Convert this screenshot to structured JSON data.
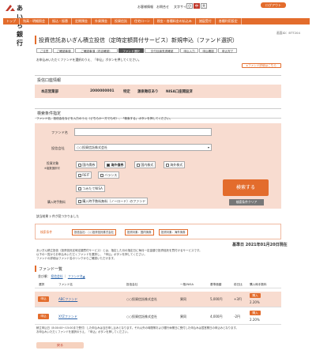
{
  "header": {
    "bank_name": "あいち銀行",
    "links": [
      "お客様情報",
      "お問合せ"
    ],
    "font_size_label": "文字サイズ",
    "font_sizes": [
      "小",
      "中",
      "大"
    ],
    "logout": "ログアウト"
  },
  "nav": {
    "items": [
      "トップ",
      "残高・明細照会",
      "振込・振替",
      "定期預金",
      "外貨預金",
      "投資信託",
      "住宅ローン",
      "税金・各種料金の払込み",
      "諸届受付",
      "各種利用設定"
    ]
  },
  "screen_id": "画面ID：BTT204",
  "page": {
    "title": "投資信託あいぎん積立投信（定時定額買付サービス）新規申込（ファンド選択）",
    "steps": [
      "ご注意",
      "ご確認事項",
      "ご確認事項（内容確認）",
      "ファンド選択",
      "交付目論見書確認",
      "申込入力",
      "申込確認",
      "申込完了"
    ],
    "active_step": 3,
    "instruction": "お申込みいただくファンドを選択のうえ、「申込」ボタンを押してください。",
    "doc_link": "ファンド詳細はこちら"
  },
  "account": {
    "section_title": "投信口座情報",
    "branch": "本店営業部",
    "number": "2000000001",
    "type": "特定",
    "tax": "源泉徴収あり",
    "nisa": "NISA口座開設済"
  },
  "search": {
    "section_title": "検索条件指定",
    "hint": "ファンド名、投信会社などを入力のうえ（どちらか一方でも可）、「検索する」ボタンを押してください。",
    "fund_name_label": "ファンド名",
    "fund_name_value": "",
    "company_label": "投信会社",
    "company_value": "○○投資信託株式会社",
    "target_label": "投資対象",
    "target_sub": "※複数選択可",
    "targets": [
      "国内債券",
      "海外債券",
      "国内株式",
      "海外株式",
      "REIT",
      "バランス",
      "つみたてNISA"
    ],
    "fee_label": "購入時手数料",
    "fee_option": "購入時手数料無料（ノーロード）のファンド",
    "search_button": "検索する",
    "clear_button": "検索条件クリア"
  },
  "result": {
    "count_text": "該当結果 2 件が見つかりました",
    "conditions_label": "検索条件",
    "conditions": [
      "投信会社：○○投資信託株式会社",
      "投資対象：国内債券",
      "投資対象：海外債券"
    ]
  },
  "base_date": "基準日 2021年01月20日現在",
  "notes": [
    "あいぎん積立投信（投資信託定時定額買付サービス）とは、指定した月の指定日に毎月一定金額で投資信託を買付けるサービスです。",
    "以下の一覧からお申込みいただくファンドを選択し、「申込」ボタンを押してください。",
    "ファンドの詳細はファンド名のリンクからご確認いただけます。"
  ],
  "list": {
    "title": "ファンド一覧",
    "sort_label": "並び順：",
    "sort_options": [
      "投信会社",
      "ファンド名▲"
    ],
    "headers": [
      "選択",
      "ファンド名",
      "投信会社",
      "一般/NISA",
      "基準価額",
      "前日比",
      "購入時手数料"
    ],
    "rows": [
      {
        "apply": "申込",
        "name": "ABCファンド",
        "company": "○○投資信託株式会社",
        "type": "異同",
        "nav": "5,000円",
        "change": "+3円",
        "fee_button": "購入",
        "fee": "2.20%"
      },
      {
        "apply": "申込",
        "name": "XYZファンド",
        "company": "○○投資信託株式会社",
        "type": "異同",
        "nav": "4,000円",
        "change": "-2円",
        "fee_button": "購入",
        "fee": "2.20%"
      }
    ]
  },
  "footer_notes": [
    "積立申込日（8:00:00〜15:00まで受付）した申込みは当日申し込みとなります。それ以外の時間帯および銀行休業日に受付した申込みは翌営業日の申込みとなります。",
    "お申込みいただくファンドを選択のうえ、「申込」ボタンを押してください。"
  ],
  "back_button": "戻る",
  "colors": {
    "accent": "#e36c2c",
    "highlight": "#f8dcd0"
  }
}
